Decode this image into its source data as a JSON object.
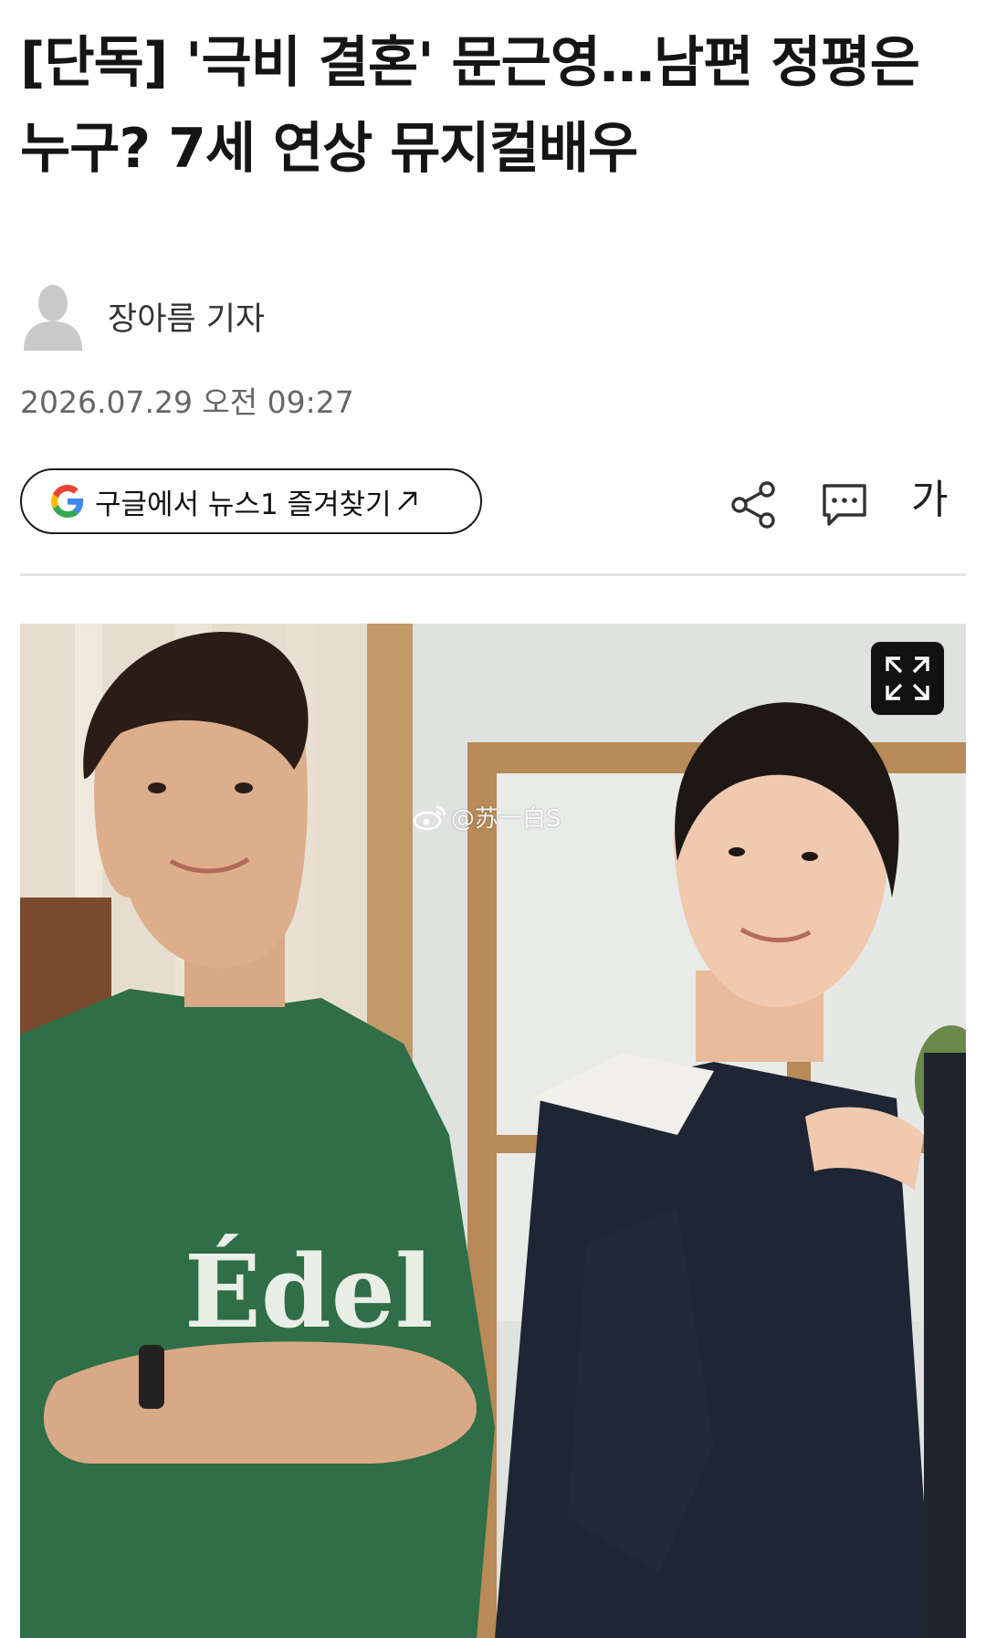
{
  "article": {
    "headline": "[단독] '극비 결혼' 문근영…남편 정평은 누구? 7세 연상 뮤지컬배우",
    "author": "장아름 기자",
    "timestamp": "2026.07.29 오전 09:27"
  },
  "toolbar": {
    "google_button_label": "구글에서 뉴스1 즐겨찾기",
    "font_size_label": "가"
  },
  "photo": {
    "watermark": "@苏一白S",
    "shirt_print": "Édel"
  },
  "colors": {
    "text_primary": "#151515",
    "text_secondary": "#666666",
    "divider": "#e6e6e6",
    "google_blue": "#4285F4",
    "google_red": "#EA4335",
    "google_yellow": "#FBBC05",
    "google_green": "#34A853"
  }
}
